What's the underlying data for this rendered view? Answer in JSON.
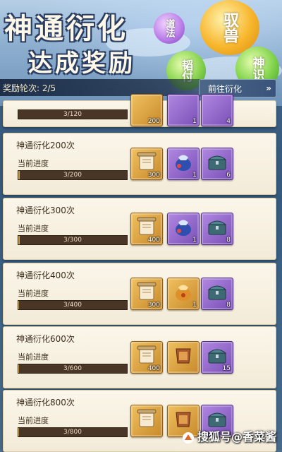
{
  "header": {
    "title_line1": "神通衍化",
    "title_line2": "达成奖励",
    "orbs": {
      "gold": "驭兽",
      "green_right": "神识",
      "green_left": "韬付",
      "purple": "道法"
    }
  },
  "round": {
    "label": "奖励轮次: 2/5"
  },
  "goto_button": {
    "label": "前往衍化",
    "icon": "chevron-right-icon"
  },
  "partial_card": {
    "progress_text": "3/120",
    "items": [
      {
        "icon": "scroll-icon",
        "count": "200"
      },
      {
        "icon": "pouch-icon",
        "count": "1"
      },
      {
        "icon": "chest-icon",
        "count": "4"
      }
    ]
  },
  "cards": [
    {
      "title": "神通衍化200次",
      "progress_label": "当前进度",
      "progress_text": "3/200",
      "progress_fraction": 0.015,
      "items": [
        {
          "icon": "scroll-icon",
          "count": "300"
        },
        {
          "icon": "blue-pouch-icon",
          "count": "1"
        },
        {
          "icon": "chest-icon",
          "count": "6"
        }
      ]
    },
    {
      "title": "神通衍化300次",
      "progress_label": "当前进度",
      "progress_text": "3/300",
      "progress_fraction": 0.01,
      "items": [
        {
          "icon": "scroll-icon",
          "count": "400"
        },
        {
          "icon": "blue-pouch-icon",
          "count": "1"
        },
        {
          "icon": "chest-icon",
          "count": "8"
        }
      ]
    },
    {
      "title": "神通衍化400次",
      "progress_label": "当前进度",
      "progress_text": "3/400",
      "progress_fraction": 0.0075,
      "items": [
        {
          "icon": "scroll-icon",
          "count": "300"
        },
        {
          "icon": "gold-pouch-icon",
          "count": "1"
        },
        {
          "icon": "chest-icon",
          "count": "8"
        }
      ]
    },
    {
      "title": "神通衍化600次",
      "progress_label": "当前进度",
      "progress_text": "3/600",
      "progress_fraction": 0.005,
      "items": [
        {
          "icon": "scroll-icon",
          "count": "400"
        },
        {
          "icon": "armor-icon",
          "count": ""
        },
        {
          "icon": "chest-icon",
          "count": "15"
        }
      ]
    },
    {
      "title": "神通衍化800次",
      "progress_label": "当前进度",
      "progress_text": "3/800",
      "progress_fraction": 0.00375,
      "items": [
        {
          "icon": "scroll-icon",
          "count": ""
        },
        {
          "icon": "armor-icon",
          "count": ""
        },
        {
          "icon": "chest-icon",
          "count": ""
        }
      ]
    }
  ],
  "watermark": {
    "text": "搜狐号@香菜酱"
  }
}
